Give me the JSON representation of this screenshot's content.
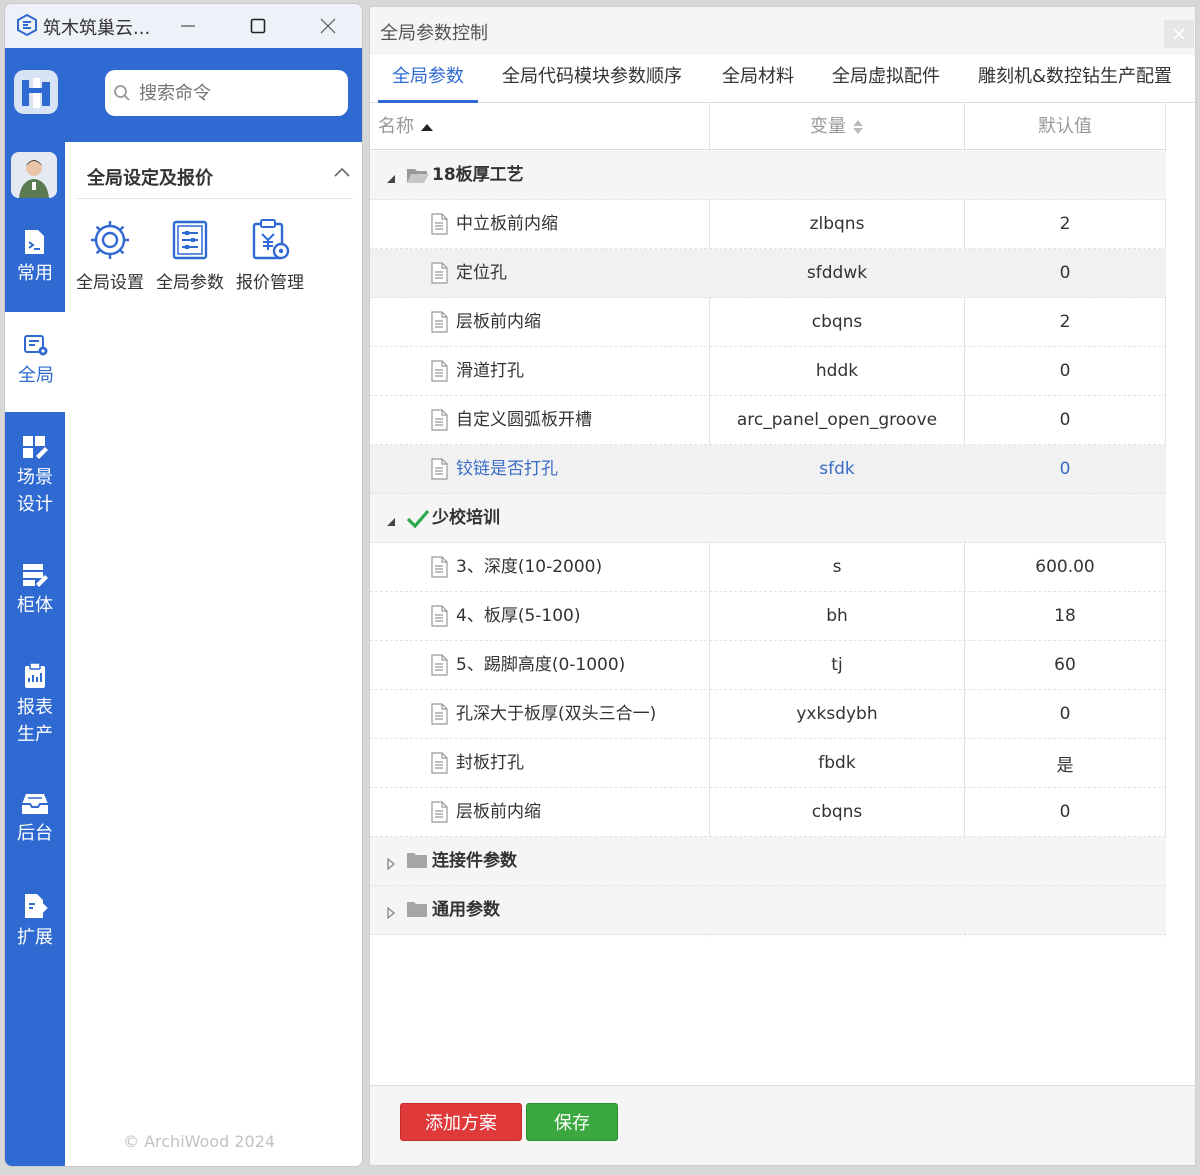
{
  "app": {
    "title": "筑木筑巢云...",
    "window_controls": {
      "minimize_glyph": "—",
      "close_glyph": "✕"
    },
    "search": {
      "placeholder": "搜索命令"
    },
    "nav": [
      {
        "id": "common",
        "label": "常用",
        "icon": "code-file-icon"
      },
      {
        "id": "global",
        "label": "全局",
        "icon": "global-settings-icon",
        "active": true
      },
      {
        "id": "scene",
        "label": "场景\n设计",
        "label_lines": [
          "场景",
          "设计"
        ],
        "icon": "scene-design-icon"
      },
      {
        "id": "cabinet",
        "label": "柜体",
        "icon": "cabinet-icon"
      },
      {
        "id": "report",
        "label": "报表\n生产",
        "label_lines": [
          "报表",
          "生产"
        ],
        "icon": "report-icon"
      },
      {
        "id": "backend",
        "label": "后台",
        "icon": "inbox-icon"
      },
      {
        "id": "extend",
        "label": "扩展",
        "icon": "extension-icon"
      }
    ],
    "section": {
      "title": "全局设定及报价",
      "tools": [
        {
          "label": "全局设置",
          "icon": "gear-icon"
        },
        {
          "label": "全局参数",
          "icon": "parameter-list-icon"
        },
        {
          "label": "报价管理",
          "icon": "quote-management-icon"
        }
      ]
    },
    "copyright": "© ArchiWood 2024"
  },
  "dialog": {
    "title": "全局参数控制",
    "tabs": [
      "全局参数",
      "全局代码模块参数顺序",
      "全局材料",
      "全局虚拟配件",
      "雕刻机&数控钻生产配置"
    ],
    "active_tab": 0,
    "columns": {
      "name": "名称",
      "variable": "变量",
      "default": "默认值"
    },
    "groups": [
      {
        "name": "18板厚工艺",
        "expanded": true,
        "icon": "folder-open-icon",
        "rows": [
          {
            "name": "中立板前内缩",
            "variable": "zlbqns",
            "default": "2"
          },
          {
            "name": "定位孔",
            "variable": "sfddwk",
            "default": "0"
          },
          {
            "name": "层板前内缩",
            "variable": "cbqns",
            "default": "2"
          },
          {
            "name": "滑道打孔",
            "variable": "hddk",
            "default": "0"
          },
          {
            "name": "自定义圆弧板开槽",
            "variable": "arc_panel_open_groove",
            "default": "0"
          },
          {
            "name": "铰链是否打孔",
            "variable": "sfdk",
            "default": "0",
            "selected": true
          }
        ]
      },
      {
        "name": "少校培训",
        "expanded": true,
        "icon": "checkmark-icon",
        "rows": [
          {
            "name": "3、深度(10-2000)",
            "variable": "s",
            "default": "600.00"
          },
          {
            "name": "4、板厚(5-100)",
            "variable": "bh",
            "default": "18"
          },
          {
            "name": "5、踢脚高度(0-1000)",
            "variable": "tj",
            "default": "60"
          },
          {
            "name": "孔深大于板厚(双头三合一)",
            "variable": "yxksdybh",
            "default": "0"
          },
          {
            "name": "封板打孔",
            "variable": "fbdk",
            "default": "是"
          },
          {
            "name": "层板前内缩",
            "variable": "cbqns",
            "default": "0"
          }
        ]
      },
      {
        "name": "连接件参数",
        "expanded": false,
        "icon": "folder-icon",
        "rows": []
      },
      {
        "name": "通用参数",
        "expanded": false,
        "icon": "folder-icon",
        "rows": []
      }
    ],
    "buttons": {
      "add_scheme": "添加方案",
      "save": "保存"
    },
    "colors": {
      "accent": "#2f6ad3",
      "danger": "#e0393a",
      "success": "#3aa83f"
    }
  }
}
